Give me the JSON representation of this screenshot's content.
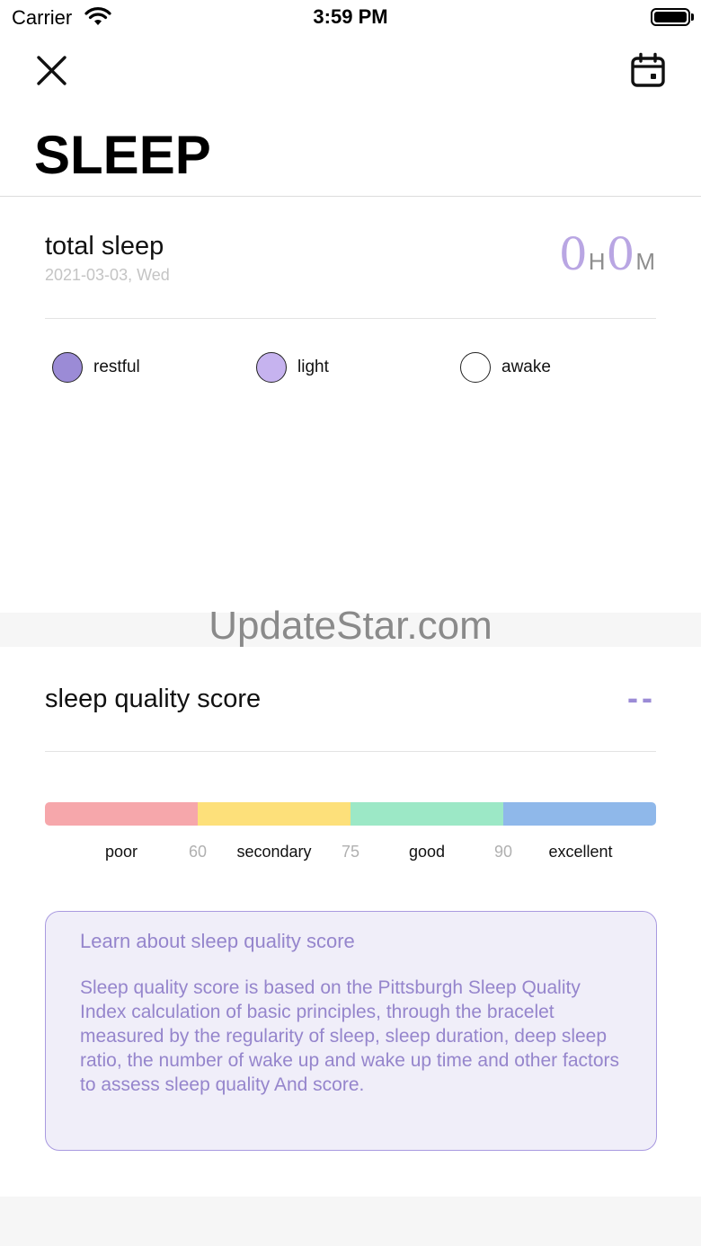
{
  "status_bar": {
    "carrier": "Carrier",
    "time": "3:59 PM"
  },
  "header": {
    "title": "SLEEP",
    "close_icon": "close-icon",
    "calendar_icon": "calendar-icon"
  },
  "total_sleep": {
    "label": "total sleep",
    "date": "2021-03-03, Wed",
    "hours": "0",
    "hours_unit": "H",
    "minutes": "0",
    "minutes_unit": "M"
  },
  "legend": [
    {
      "label": "restful",
      "color": "#9b8bd6"
    },
    {
      "label": "light",
      "color": "#c6b3ef"
    },
    {
      "label": "awake",
      "color": "#ffffff"
    }
  ],
  "watermark": "UpdateStar.com",
  "quality": {
    "label": "sleep quality score",
    "value": "--"
  },
  "scale": {
    "segments": [
      {
        "color": "#f6a7ab"
      },
      {
        "color": "#fde07a"
      },
      {
        "color": "#9ce8c6"
      },
      {
        "color": "#8fb8ea"
      }
    ],
    "categories": [
      "poor",
      "secondary",
      "good",
      "excellent"
    ],
    "thresholds": [
      "60",
      "75",
      "90"
    ]
  },
  "info": {
    "title": "Learn about sleep quality score",
    "body": "Sleep quality score is based on the Pittsburgh Sleep Quality Index calculation of basic principles, through the bracelet measured by the regularity of sleep, sleep duration, deep sleep ratio, the number of wake up and wake up time and other factors to assess sleep quality And score."
  },
  "colors": {
    "accent": "#9b8bd6",
    "info_background": "#f0eef9",
    "info_border": "#a99ae0"
  }
}
